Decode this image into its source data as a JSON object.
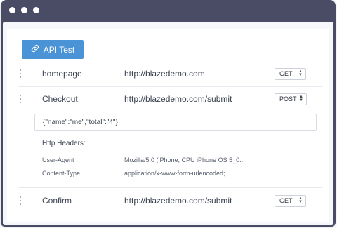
{
  "api_button": {
    "label": "API Test",
    "icon": "link-icon"
  },
  "requests": [
    {
      "name": "homepage",
      "url": "http://blazedemo.com",
      "method": "GET"
    },
    {
      "name": "Checkout",
      "url": "http://blazedemo.com/submit",
      "method": "POST"
    },
    {
      "name": "Confirm",
      "url": "http://blazedemo.com/submit",
      "method": "GET"
    }
  ],
  "checkout_details": {
    "body": "{\"name\":\"me\",\"total\":\"4\"}",
    "headers_title": "Http Headers:",
    "headers": [
      {
        "key": "User-Agent",
        "value": "Mozilla/5.0 (iPhone; CPU iPhone OS 5_0..."
      },
      {
        "key": "Content-Type",
        "value": "application/x-www-form-urlencoded;..."
      }
    ]
  },
  "colors": {
    "frame": "#4a4b64",
    "accent": "#4a93d6"
  }
}
